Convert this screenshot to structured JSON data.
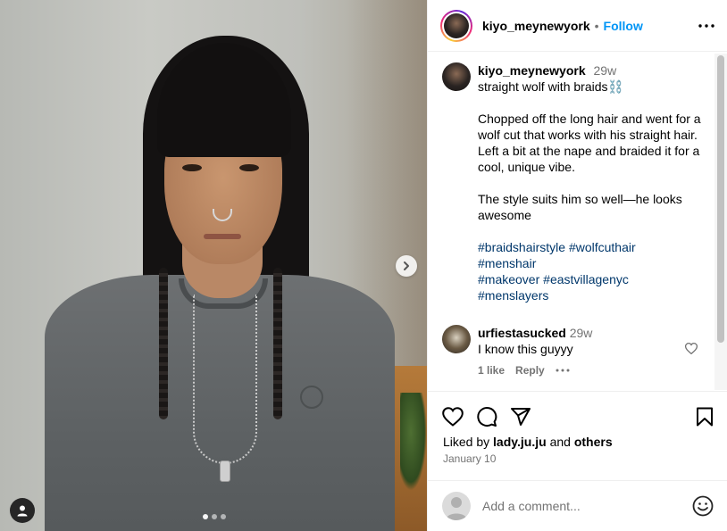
{
  "post": {
    "username": "kiyo_meynewyork",
    "follow_label": "Follow",
    "separator": "•",
    "caption": {
      "time": "29w",
      "line1": "straight wolf with braids⛓️",
      "para2": "Chopped off the long hair and went for a wolf cut that works with his straight hair. Left a bit at the nape and braided it for a cool, unique vibe.",
      "para3": "The style suits him so well—he looks awesome",
      "hashtags": [
        "#braidshairstyle",
        "#wolfcuthair",
        "#menshair",
        "#makeover",
        "#eastvillagenyc",
        "#menslayers"
      ]
    },
    "comments": [
      {
        "username": "urfiestasucked",
        "time": "29w",
        "text": "I know this guyyy",
        "likes": "1 like",
        "reply": "Reply"
      }
    ],
    "likes": {
      "prefix": "Liked by",
      "user": "lady.ju.ju",
      "joiner": "and",
      "others": "others"
    },
    "date": "January 10",
    "add_comment_placeholder": "Add a comment..."
  },
  "icons": {
    "more": "more-horizontal-icon",
    "like": "heart-icon",
    "comment": "comment-bubble-icon",
    "share": "paper-plane-icon",
    "save": "bookmark-icon",
    "emoji": "emoji-smile-icon",
    "next": "chevron-right-icon",
    "tagged": "user-tag-icon"
  },
  "colors": {
    "accent": "#0095f6",
    "hashtag": "#00376b",
    "muted": "#737373",
    "border": "#efefef"
  }
}
